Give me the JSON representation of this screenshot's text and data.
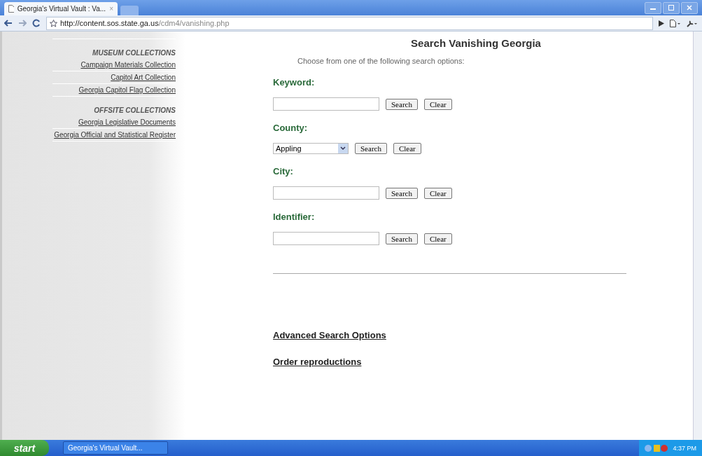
{
  "browser": {
    "tab_title": "Georgia's Virtual Vault : Va...",
    "tab_close": "×",
    "url_host": "http://content.sos.state.ga.us",
    "url_path": "/cdm4/vanishing.php"
  },
  "sidebar": {
    "sections": [
      {
        "heading": "MUSEUM COLLECTIONS",
        "links": [
          "Campaign Materials Collection",
          "Capitol Art Collection",
          "Georgia Capitol Flag Collection"
        ]
      },
      {
        "heading": "OFFSITE COLLECTIONS",
        "links": [
          "Georgia Legislative Documents",
          "Georgia Official and Statistical Register"
        ]
      }
    ]
  },
  "main": {
    "title": "Search Vanishing Georgia",
    "intro": "Choose from one of the following search options:",
    "fields": [
      {
        "label": "Keyword:",
        "kind": "text",
        "buttons": [
          "Search",
          "Clear"
        ]
      },
      {
        "label": "County:",
        "kind": "select",
        "value": "Appling",
        "buttons": [
          "Search",
          "Clear"
        ]
      },
      {
        "label": "City:",
        "kind": "text",
        "buttons": [
          "Search",
          "Clear"
        ]
      },
      {
        "label": "Identifier:",
        "kind": "text",
        "buttons": [
          "Search",
          "Clear"
        ]
      }
    ],
    "links": [
      "Advanced Search Options",
      "Order reproductions"
    ]
  },
  "taskbar": {
    "start": "start",
    "task": "Georgia's Virtual Vault...",
    "clock": "4:37 PM"
  }
}
